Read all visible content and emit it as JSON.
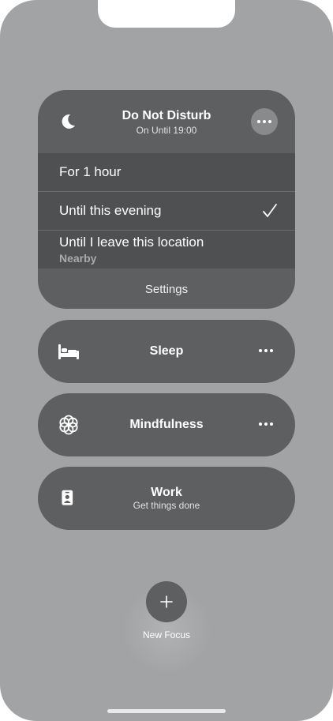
{
  "dnd": {
    "title": "Do Not Disturb",
    "subtitle": "On Until 19:00",
    "icon": "moon-icon",
    "options": [
      {
        "label": "For 1 hour",
        "selected": false
      },
      {
        "label": "Until this evening",
        "selected": true
      },
      {
        "label": "Until I leave this location",
        "sublabel": "Nearby",
        "selected": false
      }
    ],
    "settings_label": "Settings"
  },
  "focus_modes": [
    {
      "label": "Sleep",
      "icon": "bed-icon"
    },
    {
      "label": "Mindfulness",
      "icon": "flower-icon"
    },
    {
      "label": "Work",
      "sublabel": "Get things done",
      "icon": "id-badge-icon"
    }
  ],
  "new_focus": {
    "label": "New Focus",
    "icon": "plus-icon"
  },
  "colors": {
    "background": "#a2a3a4",
    "card": "#5d5f60",
    "card_dark": "#4f5051"
  }
}
